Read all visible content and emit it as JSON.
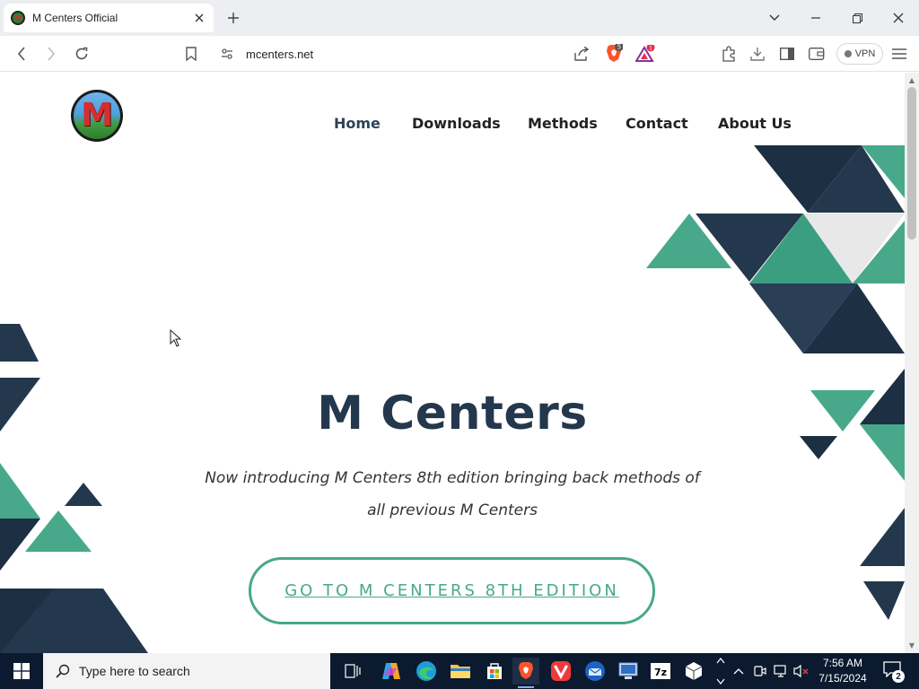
{
  "browser": {
    "tab": {
      "title": "M Centers Official",
      "favicon_letter": "M"
    },
    "url": "mcenters.net",
    "vpn_label": "VPN",
    "brave_shield_count": "5",
    "rewards_badge": "1"
  },
  "site": {
    "logo_letter": "M",
    "nav": [
      {
        "label": "Home",
        "active": true
      },
      {
        "label": "Downloads",
        "active": false
      },
      {
        "label": "Methods",
        "active": false
      },
      {
        "label": "Contact",
        "active": false
      },
      {
        "label": "About Us",
        "active": false
      }
    ],
    "hero": {
      "title": "M Centers",
      "subtitle": "Now introducing M Centers 8th edition bringing back methods of all previous M Centers",
      "cta": "GO TO M CENTERS 8TH EDITION"
    },
    "colors": {
      "navy": "#24384d",
      "teal": "#48a98a",
      "dark": "#1d2f42"
    }
  },
  "taskbar": {
    "search_placeholder": "Type here to search",
    "time": "7:56 AM",
    "date": "7/15/2024",
    "notification_count": "2",
    "apps": [
      "task-view-icon",
      "copilot-icon",
      "edge-icon",
      "file-explorer-icon",
      "store-icon",
      "brave-icon",
      "vivaldi-icon",
      "thunderbird-icon",
      "network-app-icon",
      "7zip-icon",
      "package-icon"
    ]
  }
}
